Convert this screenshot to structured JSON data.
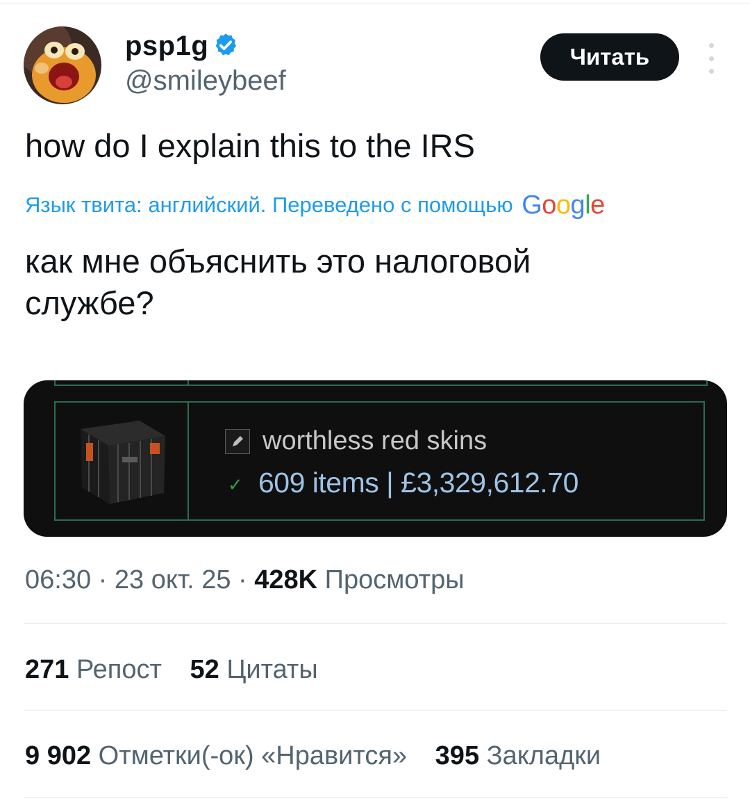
{
  "author": {
    "name": "psp1g",
    "handle": "@smileybeef"
  },
  "follow_label": "Читать",
  "tweet_text": "how do I explain this to the IRS",
  "translation": {
    "notice": "Язык твита: английский. Переведено с помощью",
    "brand": "Google",
    "text": "как мне объяснить это налоговой службе?"
  },
  "media": {
    "inventory_name": "worthless red skins",
    "inventory_stats": "609 items | £3,329,612.70"
  },
  "meta": {
    "time": "06:30",
    "date": "23 окт. 25",
    "views_count": "428K",
    "views_label": "Просмотры"
  },
  "stats": {
    "reposts_count": "271",
    "reposts_label": "Репост",
    "quotes_count": "52",
    "quotes_label": "Цитаты",
    "likes_count": "9 902",
    "likes_label": "Отметки(-ок) «Нравится»",
    "bookmarks_count": "395",
    "bookmarks_label": "Закладки"
  },
  "colors": {
    "accent": "#1d9bf0",
    "verified": "#1d9bf0",
    "button": "#0f1419",
    "muted": "#536471",
    "grid_green": "#2a6d4e"
  }
}
